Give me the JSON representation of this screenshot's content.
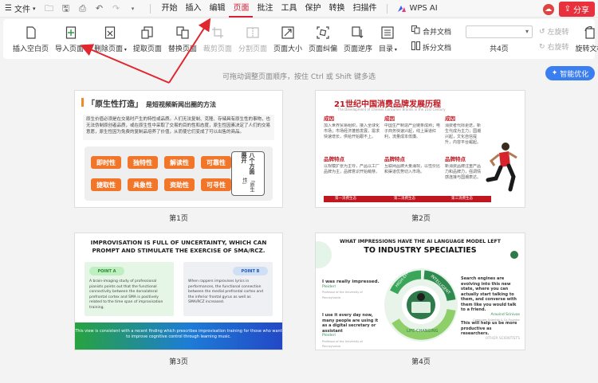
{
  "menubar": {
    "file_label": "文件",
    "tabs": [
      {
        "label": "开始",
        "active": false
      },
      {
        "label": "插入",
        "active": false
      },
      {
        "label": "编辑",
        "active": false
      },
      {
        "label": "页面",
        "active": true
      },
      {
        "label": "批注",
        "active": false
      },
      {
        "label": "工具",
        "active": false
      },
      {
        "label": "保护",
        "active": false
      },
      {
        "label": "转换",
        "active": false
      },
      {
        "label": "扫描件",
        "active": false
      }
    ],
    "wps_ai_label": "WPS AI",
    "share_label": "分享"
  },
  "ribbon": {
    "insert_blank": "插入空白页",
    "import_page": "导入页面",
    "delete_page": "删除页面",
    "extract_page": "提取页面",
    "replace_page": "替换页面",
    "crop_page": "裁剪页面",
    "split_page": "分割页面",
    "page_size": "页面大小",
    "page_skew": "页面纠偏",
    "page_order": "页面逆序",
    "toc": "目录",
    "merge_doc": "合并文档",
    "split_doc": "拆分文档",
    "page_count": "共4页",
    "rotate_left": "左旋转",
    "rotate_right": "右旋转",
    "rotate_doc": "旋转文档"
  },
  "hint": "可拖动调整页面顺序，按住 Ctrl 或 Shift 键多选",
  "smart_button": "智能优化",
  "pages": [
    {
      "caption": "第1页"
    },
    {
      "caption": "第2页"
    },
    {
      "caption": "第3页"
    },
    {
      "caption": "第4页"
    }
  ],
  "slide1": {
    "title_a": "「原生性打造」",
    "title_b": "是短视频新闻出圈的方法",
    "para": "原生价值必须是在交易时产生的特性或品质。人们无法复制、克隆、存储具有原生性的事物，也无法伪制原创者品质，或在原生性中采取了交易的目的性和态度，原生性因素决定了人们的交易意愿，原生性因为免费的复制品培养了价值，从而使它们变成了可以出售的商品。",
    "buttons": [
      "即时性",
      "独特性",
      "解读性",
      "可靠性",
      "捷取性",
      "具象性",
      "资助性",
      "可寻性"
    ],
    "side_a": "八个方面展开",
    "side_b": "「原生性」"
  },
  "slide2": {
    "title": "21世纪中国消费品牌发展历程",
    "subtitle": "The Development of Chinese Consumer Brands in the 21st Century",
    "cols": [
      {
        "h1": "成因",
        "body1": "加入世界贸易组织，接入全球化市场；市场经济蓬勃发展，需求快速增长，供给开始跟不上。",
        "h2": "品牌特点",
        "body2": "以规模扩张为主导，产品以工厂品牌为主，品牌意识开始萌芽。"
      },
      {
        "h1": "成因",
        "body1": "中国生产制造产业链条成熟；电子商务快速兴起，线上渠道红利，流量成本低廉。",
        "h2": "品牌特点",
        "body2": "互联网品牌大量涌现，以性价比和渠道优势切入市场。"
      },
      {
        "h1": "成因",
        "body1": "消费者代际更迭，新生代成为主力；国潮兴起，文化自信提升，内容平台崛起。",
        "h2": "品牌特点",
        "body2": "新消费品牌注重产品力和品牌力，强调情感连接与国潮表达。"
      }
    ],
    "stages": [
      "第一消费生态",
      "第二消费生态",
      "第三消费生态"
    ]
  },
  "slide3": {
    "title": "IMPROVISATION IS FULL OF UNCERTAINTY, WHICH CAN PROMPT AND STIMULATE THE EXERCISE OF SMA/RCZ.",
    "point_a": "POINT A",
    "point_a_text": "A brain-imaging study of professional pianists points out that the functional connectivity between the dorsolateral prefrontal cortex and SMA is positively related to the time span of improvisation training.",
    "point_b": "POINT B",
    "point_b_text": "When rappers improvises lyrics in performances, the functional connection between the medial prefrontal cortex and the inferior frontal gyrus as well as SMA/RCZ increased.",
    "band": "This view is consistent with a recent finding which prescribes improvisation training for those who want to improve cognitive control through learning music."
  },
  "slide4": {
    "title_1": "WHAT IMPRESSIONS HAVE THE AI LANGUAGE MODEL LEFT",
    "title_2": "TO INDUSTRY SPECIALTIES",
    "q1": "I was really impressed.",
    "q1_name": "Pleiderl",
    "q1_role": "Professor of the University of Pennsylvania",
    "q2": "I use it every day now, many people are using it as a digital secretary or assistant",
    "q2_name": "Pleiderl",
    "q2_role": "Professor of the University of Pennsylvania",
    "q3": "Search engines are evolving into this new state, where you can actually start talking to them, and converse with them like you would talk to a friend.",
    "q3_name": "Aravind Srinivas",
    "q3_role": "Computer Scientist & Co-Founder",
    "q4": "This will help us be more productive as researchers.",
    "q4_name": "OTHER SCIENTISTS",
    "ring_1": "HIGH-EFFICIENCY",
    "ring_2": "INTELLIGENT",
    "ring_3": "LIFE-CHANGING"
  },
  "colors": {
    "accent_red": "#d6203a",
    "orange": "#f2762a",
    "brand_blue": "#3a7ef0",
    "slide2_red": "#c0161f",
    "slide4_green": "#3aa65a"
  }
}
